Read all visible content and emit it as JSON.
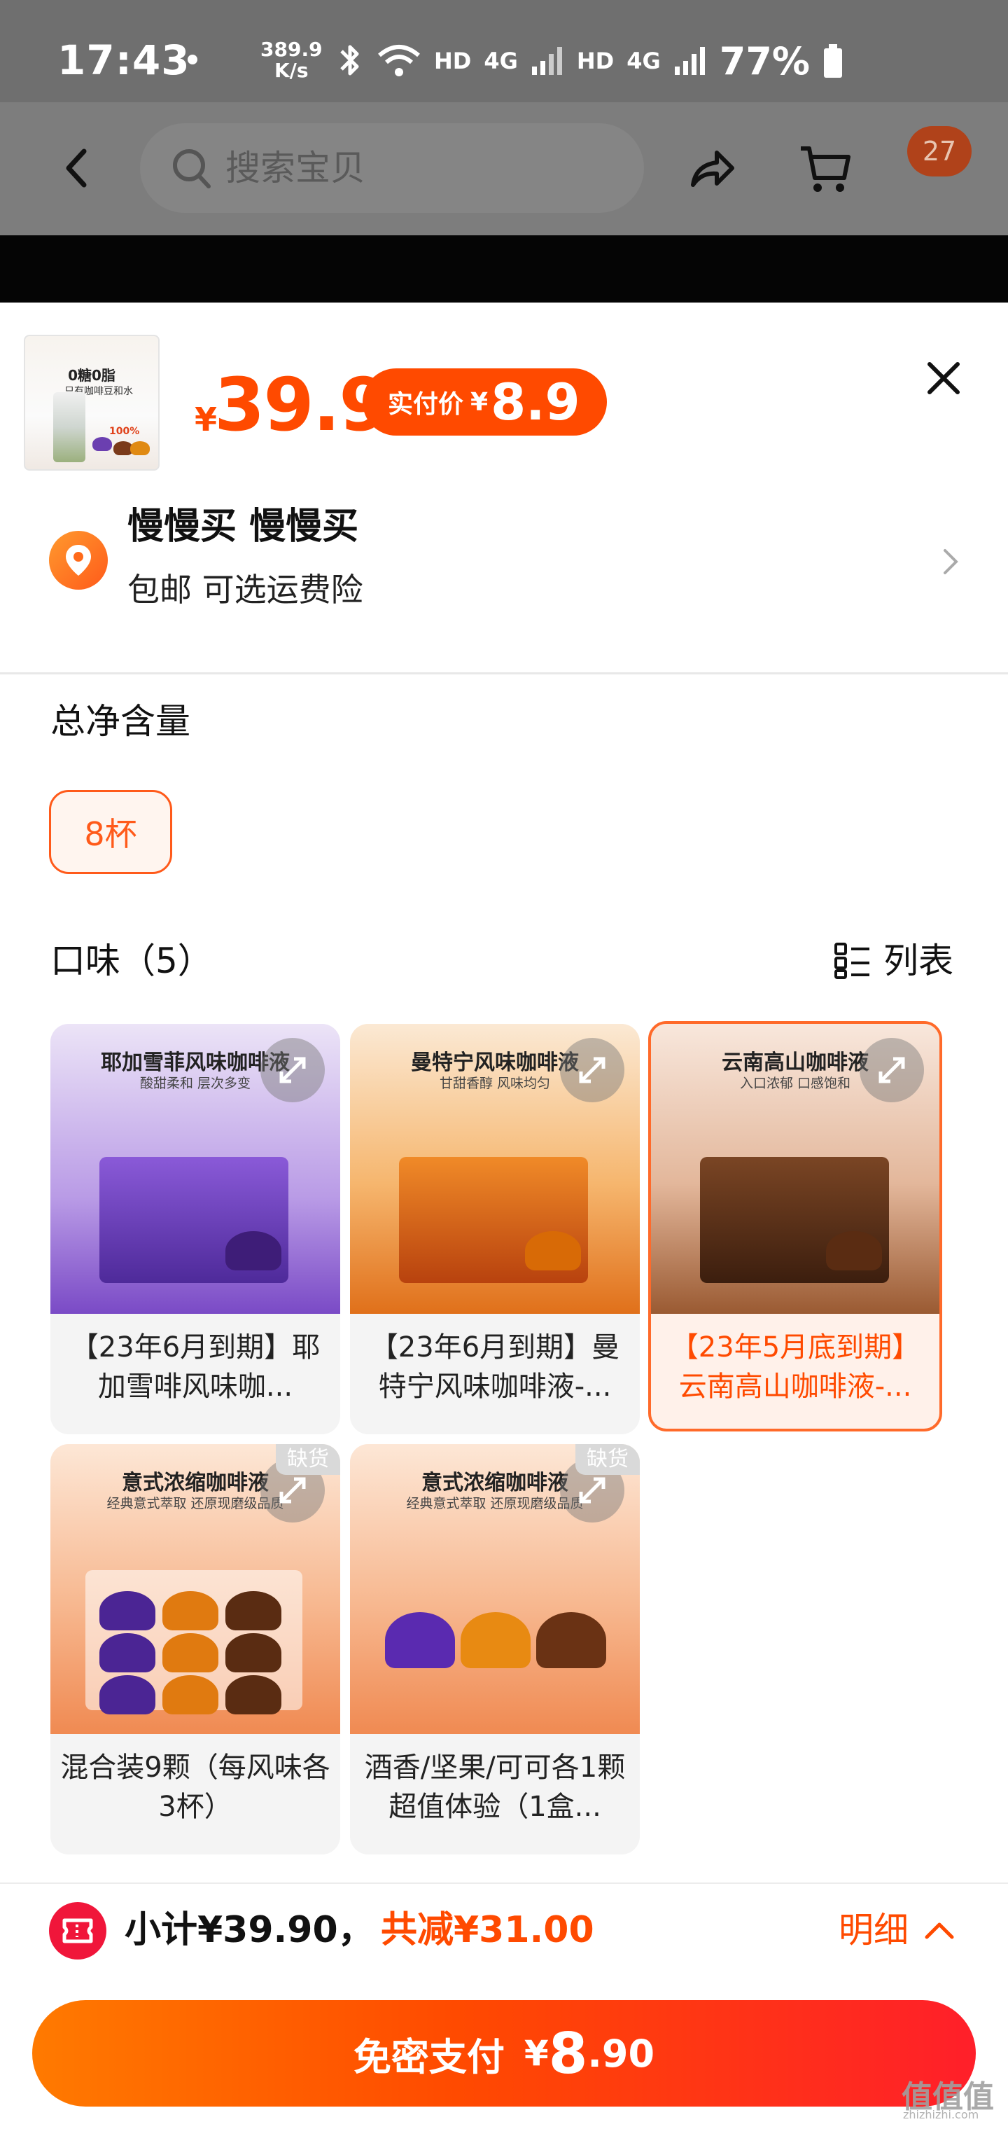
{
  "status_bar": {
    "time": "17:43",
    "net_speed_value": "389.9",
    "net_speed_unit": "K/s",
    "hd1": "HD",
    "net1": "4G",
    "hd2": "HD",
    "net2": "4G",
    "battery": "77%"
  },
  "nav": {
    "search_placeholder": "搜索宝贝",
    "cart_badge": "27"
  },
  "product": {
    "thumb_text1": "0糖0脂",
    "thumb_text2": "只有咖啡豆和水",
    "thumb_text3": "100%",
    "price_symbol": "¥",
    "price": "39.9",
    "paid_label": "实付价",
    "paid_symbol": "¥",
    "paid_value": "8.9"
  },
  "address": {
    "name": "慢慢买 慢慢买",
    "sub": "包邮  可选运费险"
  },
  "capacity": {
    "title": "总净含量",
    "option": "8杯"
  },
  "flavor": {
    "title": "口味（5）",
    "list_label": "列表",
    "cards": [
      {
        "heading": "耶加雪菲风味咖啡液",
        "subheading": "酸甜柔和 层次多变",
        "title": "【23年6月到期】耶加雪啡风味咖...",
        "selected": false,
        "out_of_stock": ""
      },
      {
        "heading": "曼特宁风味咖啡液",
        "subheading": "甘甜香醇 风味均匀",
        "title": "【23年6月到期】曼特宁风味咖啡液-...",
        "selected": false,
        "out_of_stock": ""
      },
      {
        "heading": "云南高山咖啡液",
        "subheading": "入口浓郁 口感饱和",
        "title": "【23年5月底到期】云南高山咖啡液-...",
        "selected": true,
        "out_of_stock": ""
      },
      {
        "heading": "意式浓缩咖啡液",
        "subheading": "经典意式萃取 还原现磨级品质",
        "title": "混合装9颗（每风味各3杯）",
        "selected": false,
        "out_of_stock": "缺货"
      },
      {
        "heading": "意式浓缩咖啡液",
        "subheading": "经典意式萃取 还原现磨级品质",
        "title": "酒香/坚果/可可各1颗超值体验（1盒...",
        "selected": false,
        "out_of_stock": "缺货"
      }
    ]
  },
  "footer": {
    "subtotal": "小计¥39.90，",
    "reduce": "共减¥31.00",
    "detail": "明细",
    "pay_label": "免密支付",
    "pay_symbol": "¥",
    "pay_int": "8",
    "pay_dec": ".90"
  },
  "watermark": {
    "text": "值值值",
    "sub": "zhizhizhi.com"
  },
  "colors": {
    "accent": "#ff4a00",
    "pay_gradient_start": "#ff7a00",
    "pay_gradient_end": "#ff1f2a"
  }
}
